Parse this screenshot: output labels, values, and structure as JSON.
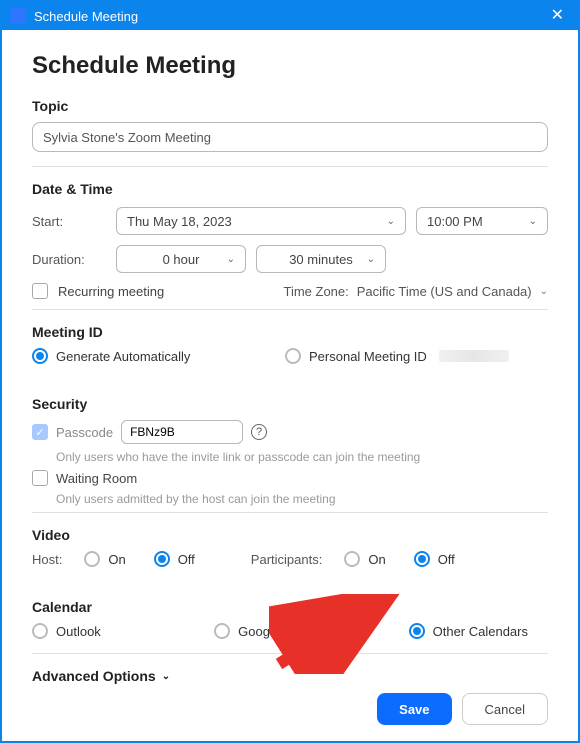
{
  "window": {
    "title": "Schedule Meeting"
  },
  "page": {
    "title": "Schedule Meeting"
  },
  "topic": {
    "header": "Topic",
    "value": "Sylvia Stone's Zoom Meeting"
  },
  "datetime": {
    "header": "Date & Time",
    "start_label": "Start:",
    "date": "Thu  May  18, 2023",
    "time": "10:00  PM",
    "duration_label": "Duration:",
    "hours": "0 hour",
    "minutes": "30 minutes",
    "recurring_label": "Recurring meeting",
    "timezone_prefix": "Time Zone:",
    "timezone_value": "Pacific Time (US and Canada)"
  },
  "meeting_id": {
    "header": "Meeting ID",
    "generate": "Generate Automatically",
    "personal": "Personal Meeting ID"
  },
  "security": {
    "header": "Security",
    "passcode_label": "Passcode",
    "passcode_value": "FBNz9B",
    "passcode_hint": "Only users who have the invite link or passcode can join the meeting",
    "waiting_label": "Waiting Room",
    "waiting_hint": "Only users admitted by the host can join the meeting"
  },
  "video": {
    "header": "Video",
    "host_label": "Host:",
    "on": "On",
    "off": "Off",
    "participants_label": "Participants:"
  },
  "calendar": {
    "header": "Calendar",
    "outlook": "Outlook",
    "google": "Google Calendar",
    "other": "Other Calendars"
  },
  "advanced": {
    "label": "Advanced Options"
  },
  "actions": {
    "save": "Save",
    "cancel": "Cancel"
  }
}
